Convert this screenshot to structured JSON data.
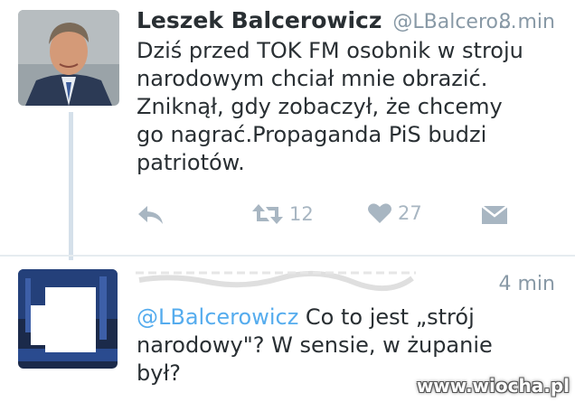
{
  "tweet1": {
    "display_name": "Leszek Balcerowicz",
    "handle": "@LBalcero...",
    "time": "8 min",
    "text": "Dziś przed TOK FM osobnik w stroju narodowym chciał mnie obrazić. Zniknął, gdy zobaczył, że chcemy go nagrać.Propaganda PiS budzi patriotów.",
    "retweet_count": "12",
    "like_count": "27",
    "icons": [
      "reply-icon",
      "retweet-icon",
      "heart-icon",
      "dm-icon"
    ]
  },
  "tweet2": {
    "time": "4 min",
    "mention": "@LBalcerowicz",
    "text": " Co to jest „strój narodowy\"? W sensie, w żupanie był?"
  },
  "watermark": "www.wiocha.pl",
  "colors": {
    "link": "#55acee",
    "muted": "#8899a6",
    "icon": "#a8b6c2",
    "text": "#292f33"
  }
}
